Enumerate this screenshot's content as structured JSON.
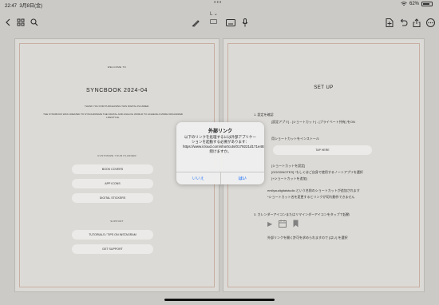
{
  "status": {
    "time": "22:47",
    "date": "3月8日(金)",
    "battery": "62%"
  },
  "toolbar": {
    "title": "L",
    "icons": [
      "chevron-left-icon",
      "grid-icon",
      "search-icon",
      "pen-icon",
      "keyboard-icon",
      "microphone-icon",
      "add-page-icon",
      "undo-icon",
      "share-icon",
      "more-icon"
    ]
  },
  "left_page": {
    "welcome": "WELCOME TO",
    "title": "SYNCBOOK  2024-04",
    "thanks": "THANK YOU FOR PURCHASING THIS DIGITAL PLANNER.",
    "description": "THE SYNCBOOK WAS CREATED TO SYNCHRONIZE THE DIGITAL AND ANALOG WORLD TO ACHIEVE A MORE ORGANIZED LIFESTYLE.",
    "customize_heading": "CUSTOMIZE YOUR PLANNER",
    "customize_buttons": [
      "BOOK COVERS",
      "APP ICONS",
      "DIGITAL STICKERS"
    ],
    "support_heading": "SUPPORT",
    "support_buttons": [
      "TUTORIALS / TIPS ON INSTAGRAM",
      "GET SUPPORT"
    ]
  },
  "right_page": {
    "title": "SET UP",
    "step1": "1.  設定を確認",
    "step1_detail": "[設定アプリ] - [ショートカット] - [プライベート共有] をON",
    "step2": "用ショートカットをインストール",
    "tap_here": "TAP HERE",
    "shortcut_setting": "[ショートカットを設定]",
    "goodnotes": "[GOODNOTES] *もしくはご自身で使用するノートアプリを選択",
    "add_home": "[+ショートカットを追加]",
    "shortcut_added": "emilysudigitalstudio という名前のショートカットが追加されます",
    "rename_note": "*ショートカット名を変更するとリンクが切れ動作できません",
    "step3": "3.  カレンダーアイコンまたはリマインダーアイコンをタップで起動",
    "step3_detail": "外部リンクを開く許可を求められますので [はい] を選択"
  },
  "dialog": {
    "title": "外部リンク",
    "message": "以下のリンクを処理するには外部アプリケーションを起動する必要があります： https://www.icloud.com/shortcuts/0179221d171e482397890f855d6be596、続けますか。",
    "cancel": "いいえ",
    "confirm": "はい"
  }
}
